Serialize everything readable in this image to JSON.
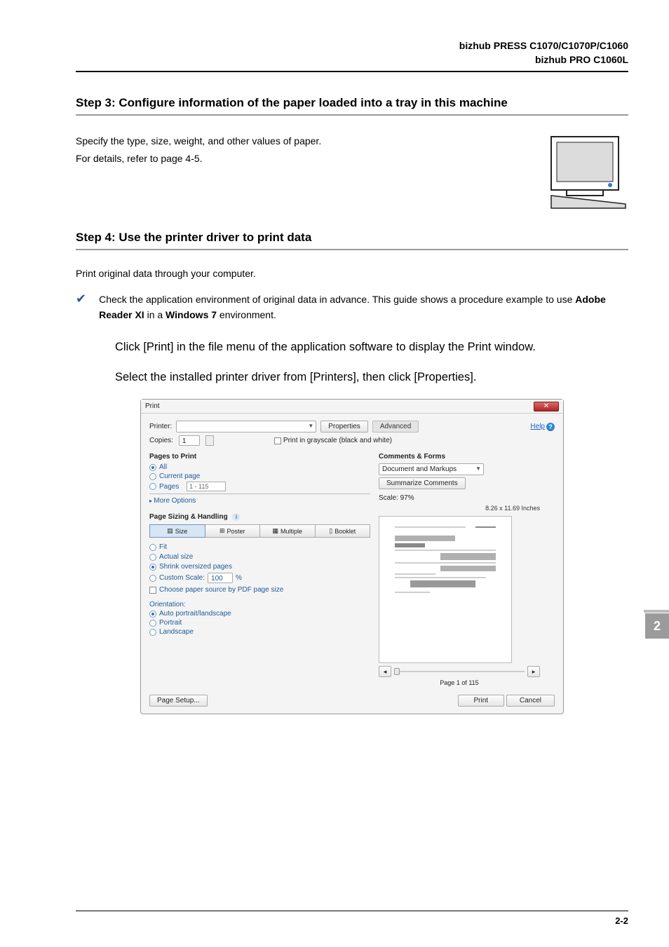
{
  "header": {
    "line1": "bizhub PRESS C1070/C1070P/C1060",
    "line2": "bizhub PRO C1060L"
  },
  "step3": {
    "title": "Step 3: Configure information of the paper loaded into a tray in this machine",
    "p1": "Specify the type, size, weight, and other values of paper.",
    "p2": "For details, refer to page 4-5."
  },
  "step4": {
    "title": "Step 4: Use the printer driver to print data",
    "p1": "Print original data through your computer.",
    "check_prefix": "Check the application environment of original data in advance. This guide shows a procedure example to use ",
    "bold1": "Adobe Reader XI",
    "mid": " in a ",
    "bold2": "Windows 7",
    "suffix": " environment.",
    "instr1": "Click [Print] in the file menu of the application software to display the Print window.",
    "instr2": "Select the installed printer driver from [Printers], then click [Properties]."
  },
  "dialog": {
    "title": "Print",
    "close": "✕",
    "printer_label": "Printer:",
    "printer_value": "",
    "properties": "Properties",
    "advanced": "Advanced",
    "help": "Help",
    "copies_label": "Copies:",
    "copies_value": "1",
    "grayscale": "Print in grayscale (black and white)",
    "pages_to_print": "Pages to Print",
    "all": "All",
    "current": "Current page",
    "pages": "Pages",
    "pages_value": "1 - 115",
    "more_options": "More Options",
    "sizing_handling": "Page Sizing & Handling",
    "size": "Size",
    "poster": "Poster",
    "multiple": "Multiple",
    "booklet": "Booklet",
    "fit": "Fit",
    "actual": "Actual size",
    "shrink": "Shrink oversized pages",
    "custom_scale": "Custom Scale:",
    "custom_scale_value": "100",
    "percent": "%",
    "choose_source": "Choose paper source by PDF page size",
    "orientation": "Orientation:",
    "auto": "Auto portrait/landscape",
    "portrait": "Portrait",
    "landscape": "Landscape",
    "comments_forms": "Comments & Forms",
    "comments_dropdown": "Document and Markups",
    "summarize": "Summarize Comments",
    "scale_label": "Scale:  97%",
    "paper_dim": "8.26 x 11.69 Inches",
    "prev": "◂",
    "next": "▸",
    "page_indicator": "Page 1 of 115",
    "page_setup": "Page Setup...",
    "print": "Print",
    "cancel": "Cancel"
  },
  "side_tab": "2",
  "page_number": "2-2"
}
